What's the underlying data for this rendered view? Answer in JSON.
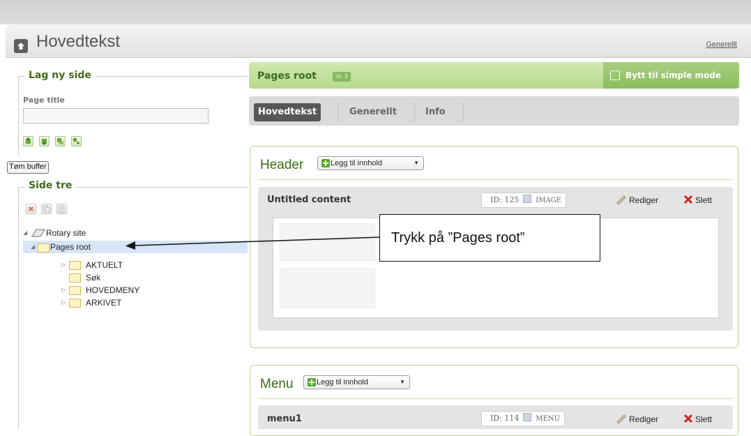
{
  "header": {
    "title": "Hovedtekst",
    "link": "Generellt"
  },
  "left": {
    "new_page_legend": "Lag ny side",
    "page_title_label": "Page title",
    "page_title_value": "",
    "buffer_button": "Tøm buffer",
    "tree_legend": "Side tre",
    "tree": {
      "root": "Rotary site",
      "pages_root": "Pages root",
      "items": [
        "AKTUELT",
        "Søk",
        "HOVEDMENY",
        "ARKIVET"
      ]
    }
  },
  "main": {
    "breadcrumb_title": "Pages root",
    "breadcrumb_id": "id: 3",
    "simple_mode_button": "Bytt til simple mode",
    "tabs": [
      "Hovedtekst",
      "Generellt",
      "Info"
    ],
    "sections": [
      {
        "title": "Header",
        "add_button": "Legg til innhold",
        "content": {
          "name": "Untitled content",
          "id": "ID: 125",
          "type": "IMAGE",
          "edit": "Rediger",
          "delete": "Slett"
        }
      },
      {
        "title": "Menu",
        "add_button": "Legg til innhold",
        "content": {
          "name": "menu1",
          "id": "ID: 114",
          "type": "MENU",
          "edit": "Rediger",
          "delete": "Slett"
        }
      }
    ]
  },
  "annotation": {
    "callout_text": "Trykk på ”Pages root”"
  },
  "colors": {
    "green_dark": "#3b6b18",
    "green_bar": "#b6d98e",
    "tab_active": "#575757",
    "selection": "#d6e5f8"
  }
}
